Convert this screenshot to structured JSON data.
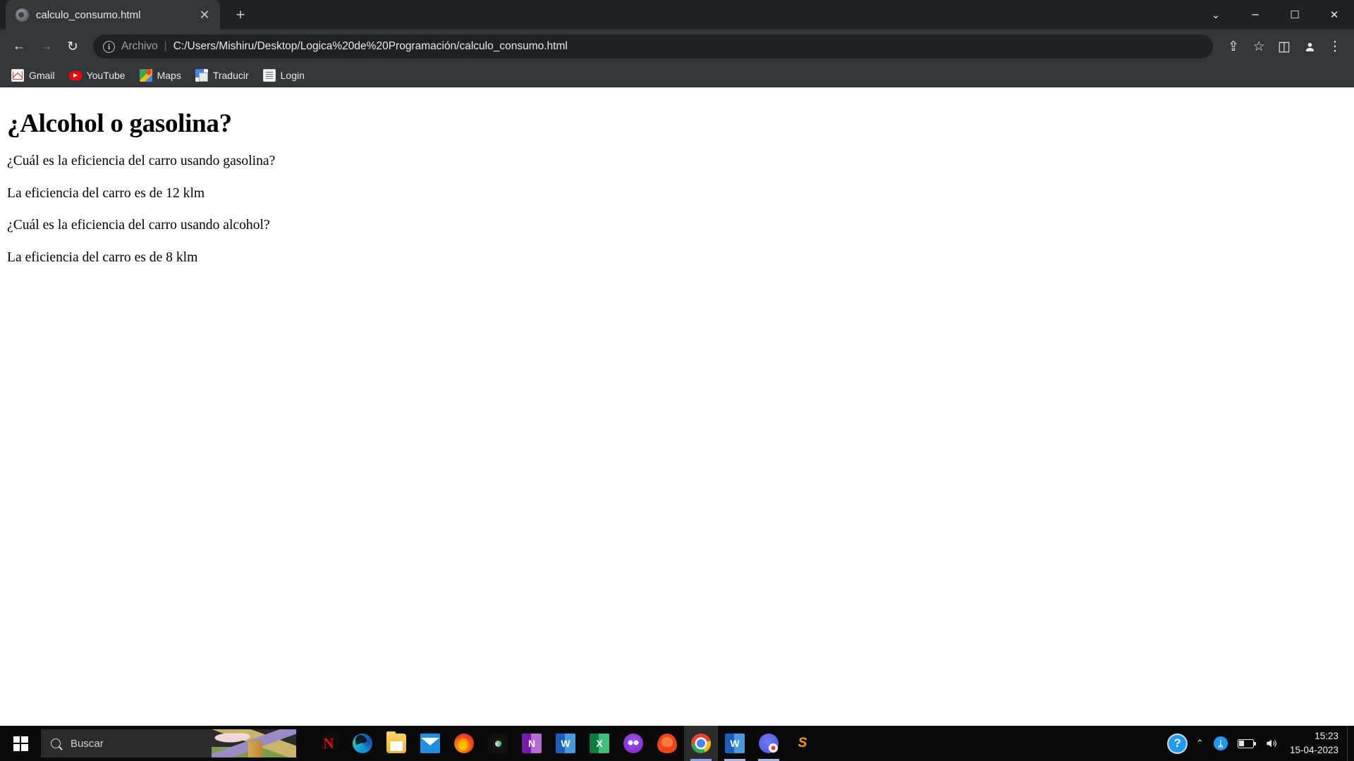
{
  "browser": {
    "tab": {
      "title": "calculo_consumo.html",
      "favicon": "globe-icon",
      "close_label": "✕"
    },
    "new_tab_label": "+",
    "window_controls": {
      "more": "⌄",
      "minimize": "─",
      "maximize": "☐",
      "close": "✕"
    },
    "nav": {
      "back": "←",
      "forward": "→",
      "reload": "↻"
    },
    "omnibox": {
      "info_icon": "ⓘ",
      "scheme_label": "Archivo",
      "separator": "|",
      "url": "C:/Users/Mishiru/Desktop/Logica%20de%20Programación/calculo_consumo.html"
    },
    "toolbar_right": {
      "share": "⇪",
      "bookmark_star": "☆",
      "side_panel": "◫",
      "profile": "●",
      "menu": "⋮"
    },
    "bookmarks": [
      {
        "label": "Gmail",
        "icon": "gmail-icon"
      },
      {
        "label": "YouTube",
        "icon": "youtube-icon"
      },
      {
        "label": "Maps",
        "icon": "google-maps-icon"
      },
      {
        "label": "Traducir",
        "icon": "google-translate-icon"
      },
      {
        "label": "Login",
        "icon": "document-icon"
      }
    ]
  },
  "page": {
    "heading": "¿Alcohol o gasolina?",
    "lines": [
      "¿Cuál es la eficiencia del carro usando gasolina?",
      "La eficiencia del carro es de 12 klm",
      "¿Cuál es la eficiencia del carro usando alcohol?",
      "La eficiencia del carro es de 8 klm"
    ]
  },
  "taskbar": {
    "start_label": "windows-logo",
    "search": {
      "placeholder": "Buscar",
      "icon": "search-icon"
    },
    "apps": [
      {
        "name": "netflix",
        "icon": "netflix-icon",
        "glyph": "N",
        "class": "ti-netflix",
        "running": false,
        "active": false
      },
      {
        "name": "edge",
        "icon": "edge-icon",
        "glyph": "",
        "class": "ti-edge",
        "running": false,
        "active": false
      },
      {
        "name": "explorer",
        "icon": "file-explorer-icon",
        "glyph": "",
        "class": "ti-folder",
        "running": false,
        "active": false
      },
      {
        "name": "mail",
        "icon": "mail-icon",
        "glyph": "",
        "class": "ti-mail",
        "running": false,
        "active": false
      },
      {
        "name": "firefox",
        "icon": "firefox-icon",
        "glyph": "",
        "class": "ti-firefox",
        "running": false,
        "active": false
      },
      {
        "name": "obs",
        "icon": "obs-studio-icon",
        "glyph": "",
        "class": "ti-obs",
        "running": false,
        "active": false
      },
      {
        "name": "onenote",
        "icon": "onenote-icon",
        "glyph": "N",
        "class": "ti-onenote",
        "running": false,
        "active": false
      },
      {
        "name": "word-pin",
        "icon": "word-icon",
        "glyph": "W",
        "class": "ti-word",
        "running": false,
        "active": false
      },
      {
        "name": "excel",
        "icon": "excel-icon",
        "glyph": "X",
        "class": "ti-excel",
        "running": false,
        "active": false
      },
      {
        "name": "discord",
        "icon": "discord-icon",
        "glyph": "",
        "class": "ti-discord",
        "running": false,
        "active": false
      },
      {
        "name": "brave",
        "icon": "brave-icon",
        "glyph": "",
        "class": "ti-brave",
        "running": false,
        "active": false
      },
      {
        "name": "chrome",
        "icon": "chrome-icon",
        "glyph": "",
        "class": "ti-chrome",
        "running": true,
        "active": true
      },
      {
        "name": "word",
        "icon": "word-icon",
        "glyph": "W",
        "class": "ti-word",
        "running": true,
        "active": false
      },
      {
        "name": "discord2",
        "icon": "discord-icon",
        "glyph": "",
        "class": "ti-discord2",
        "running": true,
        "active": false
      },
      {
        "name": "sublime",
        "icon": "sublime-text-icon",
        "glyph": "S",
        "class": "ti-sublime",
        "running": false,
        "active": false
      }
    ],
    "tray": {
      "help_glyph": "?",
      "chevron": "⌃",
      "bluetooth_glyph": "ᛦ",
      "battery_icon": "battery-icon",
      "volume_glyph": "🔊",
      "time": "15:23",
      "date": "15-04-2023"
    }
  }
}
